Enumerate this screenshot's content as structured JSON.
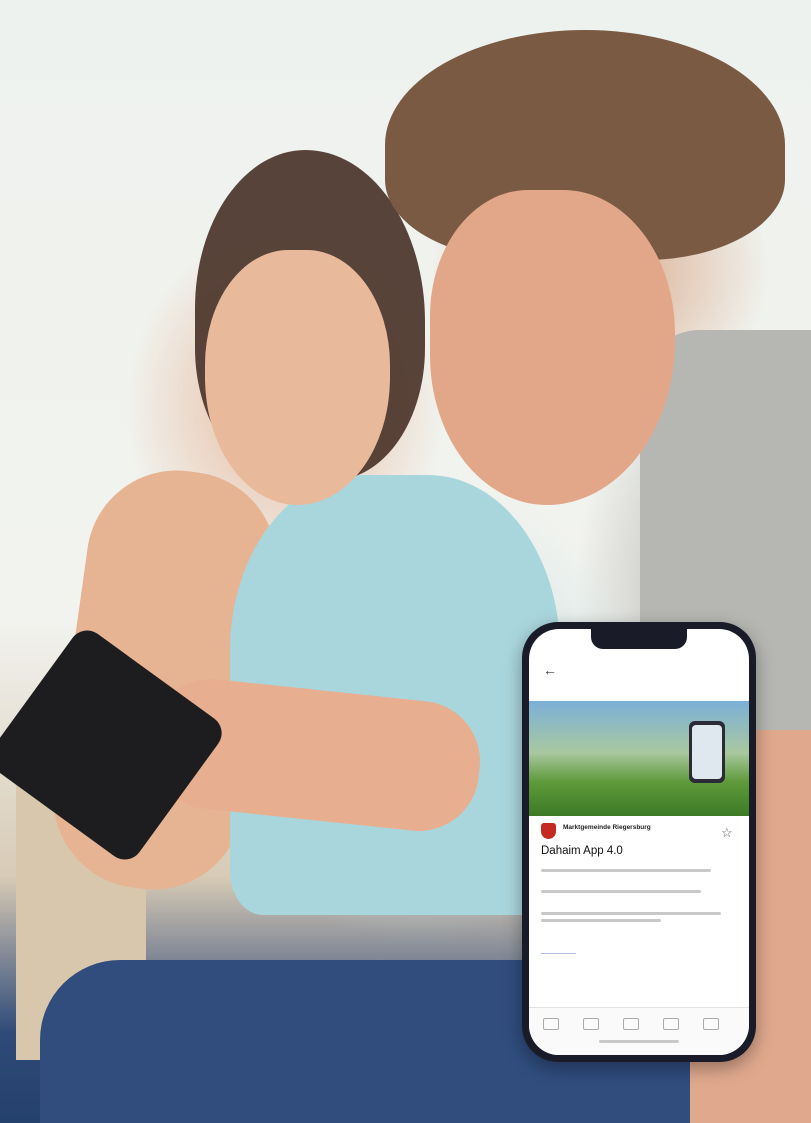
{
  "scene": {
    "colors": {
      "background": "#f2f3ef",
      "jeans": "#304d7e",
      "top": "#a9d6dc",
      "phone_frame": "#1a1b29"
    }
  },
  "phone": {
    "org_name": "Marktgemeinde Riegersburg",
    "app_title": "Dahaim App 4.0",
    "icons": [
      "back-arrow-icon",
      "crest-icon",
      "star-icon",
      "home-icon"
    ]
  }
}
